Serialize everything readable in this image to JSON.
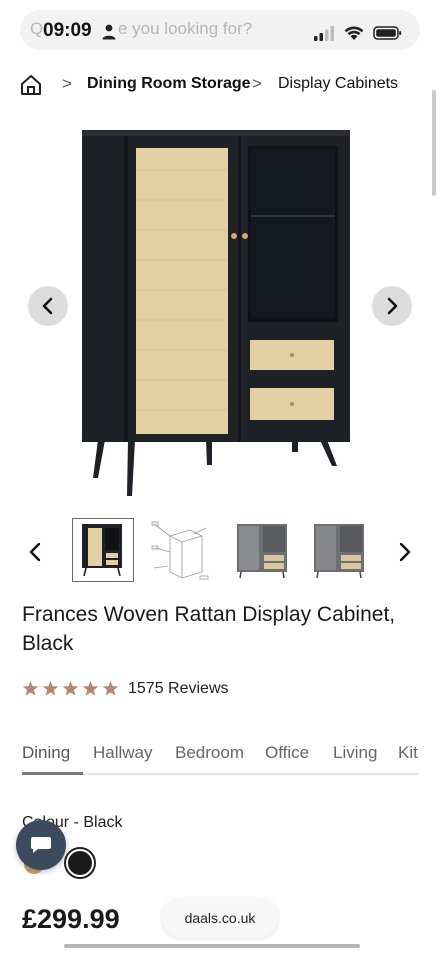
{
  "status_bar": {
    "time": "09:09"
  },
  "search": {
    "placeholder": "Q    e you looking for?"
  },
  "breadcrumb": {
    "items": [
      "Dining Room Storage",
      "Display Cabinets"
    ],
    "separator": ">"
  },
  "product": {
    "title": "Frances Woven Rattan Display Cabinet, Black",
    "rating": 5,
    "reviews_label": "1575 Reviews",
    "colour_label": "Colour - Black",
    "price": "£299.99"
  },
  "tabs": {
    "items": [
      "Dining",
      "Hallway",
      "Bedroom",
      "Office",
      "Living",
      "Kit"
    ],
    "active_index": 0
  },
  "browser": {
    "domain": "daals.co.uk"
  },
  "colors": {
    "star": "#b8876a",
    "chat_button": "#3b4a5c",
    "cabinet": "#1e2126",
    "rattan": "#e3cfa2"
  },
  "icons": [
    "person-icon",
    "signal-icon",
    "wifi-icon",
    "battery-icon",
    "home-icon",
    "chevron-left-icon",
    "chevron-right-icon",
    "star-icon",
    "chat-icon"
  ]
}
